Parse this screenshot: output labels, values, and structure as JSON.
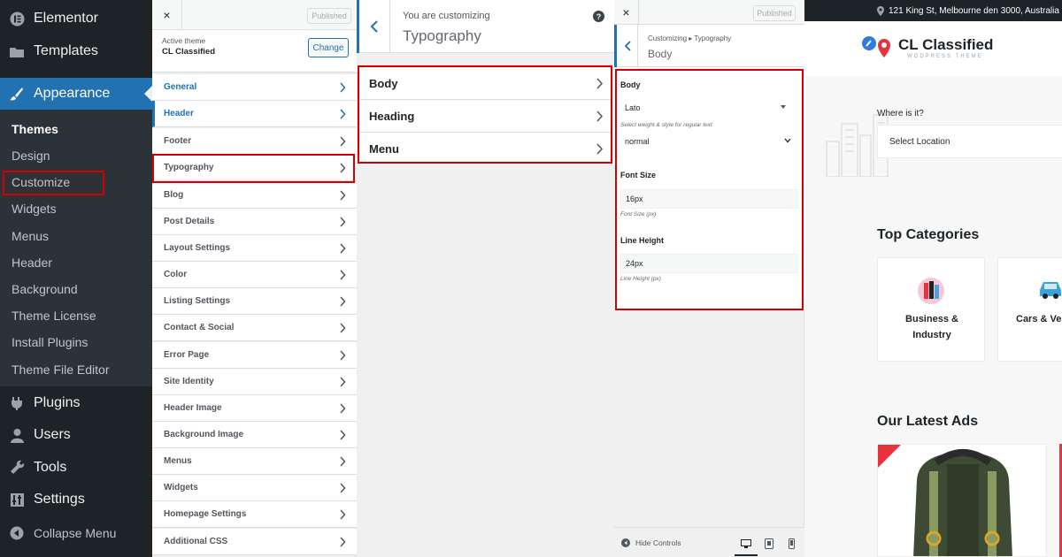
{
  "wp_sidebar": {
    "top_items": [
      {
        "label": "Elementor",
        "icon": "elementor-icon"
      },
      {
        "label": "Templates",
        "icon": "folder-icon"
      },
      {
        "label": "Appearance",
        "icon": "paintbrush-icon"
      }
    ],
    "sub_items": [
      "Themes",
      "Design",
      "Customize",
      "Widgets",
      "Menus",
      "Header",
      "Background",
      "Theme License",
      "Install Plugins",
      "Theme File Editor"
    ],
    "bottom_items": [
      {
        "label": "Plugins",
        "icon": "plug-icon"
      },
      {
        "label": "Users",
        "icon": "user-icon"
      },
      {
        "label": "Tools",
        "icon": "wrench-icon"
      },
      {
        "label": "Settings",
        "icon": "settings-icon"
      }
    ],
    "collapse_label": "Collapse Menu"
  },
  "panel1": {
    "close": "×",
    "published": "Published",
    "active_theme_label": "Active theme",
    "theme_name": "CL Classified",
    "change_label": "Change",
    "sections": [
      "General",
      "Header",
      "Footer",
      "Typography",
      "Blog",
      "Post Details",
      "Layout Settings",
      "Color",
      "Listing Settings",
      "Contact & Social",
      "Error Page",
      "Site Identity",
      "Header Image",
      "Background Image",
      "Menus",
      "Widgets",
      "Homepage Settings",
      "Additional CSS"
    ]
  },
  "panel2": {
    "customizing_label": "You are customizing",
    "title": "Typography",
    "help": "?",
    "items": [
      "Body",
      "Heading",
      "Menu"
    ]
  },
  "panel3": {
    "close": "×",
    "published": "Published",
    "breadcrumb": "Customizing ▸ Typography",
    "title": "Body",
    "section_label": "Body",
    "font_value": "Lato",
    "font_hint": "Select weight & style for regular text",
    "weight_value": "normal",
    "font_size_label": "Font Size",
    "font_size_value": "16px",
    "font_size_hint": "Font Size (px)",
    "line_height_label": "Line Height",
    "line_height_value": "24px",
    "line_height_hint": "Line Height (px)",
    "hide_controls": "Hide Controls"
  },
  "preview": {
    "address": "121 King St, Melbourne den 3000, Australia",
    "logo_title": "CL Classified",
    "logo_sub": "WODPRESS THEME",
    "where_label": "Where is it?",
    "location_placeholder": "Select Location",
    "top_categories": "Top Categories",
    "categories": [
      {
        "line1": "Business &",
        "line2": "Industry"
      },
      {
        "line1": "Cars & Ve",
        "line2": ""
      }
    ],
    "latest_ads": "Our Latest Ads"
  },
  "colors": {
    "accent": "#2271b1",
    "highlight": "#d40000",
    "admin_bg": "#1d2327",
    "brand_red": "#e8323c"
  }
}
